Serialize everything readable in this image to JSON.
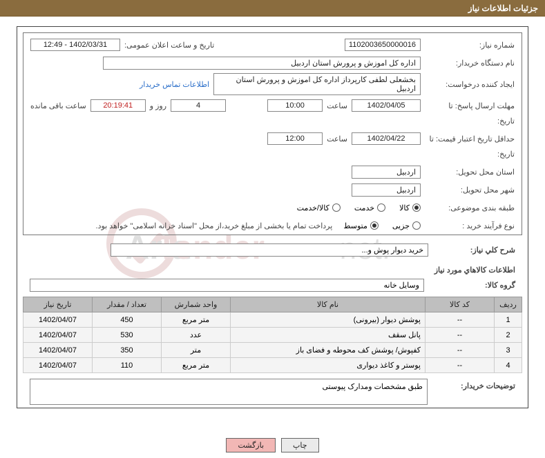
{
  "header": {
    "title": "جزئیات اطلاعات نیاز"
  },
  "fields": {
    "need_no_label": "شماره نیاز:",
    "need_no": "1102003650000016",
    "announce_label": "تاریخ و ساعت اعلان عمومی:",
    "announce_value": "1402/03/31 - 12:49",
    "buyer_org_label": "نام دستگاه خریدار:",
    "buyer_org": "اداره کل اموزش و پرورش استان اردبیل",
    "requester_label": "ایجاد کننده درخواست:",
    "requester": "بخشعلی لطفی کارپرداز اداره کل اموزش و پرورش استان اردبیل",
    "contact_link": "اطلاعات تماس خریدار",
    "deadline_until_label": "مهلت ارسال پاسخ: تا",
    "deadline_date": "1402/04/05",
    "hour_label": "ساعت",
    "deadline_time": "10:00",
    "days_count": "4",
    "days_label": "روز و",
    "countdown": "20:19:41",
    "remaining_label": "ساعت باقی مانده",
    "date_sublabel": "تاریخ:",
    "validity_until_label": "حداقل تاریخ اعتبار قیمت: تا",
    "validity_date": "1402/04/22",
    "validity_time": "12:00",
    "delivery_province_label": "استان محل تحویل:",
    "delivery_province": "اردبیل",
    "delivery_city_label": "شهر محل تحویل:",
    "delivery_city": "اردبیل",
    "subject_class_label": "طبقه بندی موضوعی:",
    "subject_options": [
      "کالا",
      "خدمت",
      "کالا/خدمت"
    ],
    "subject_selected": 0,
    "purchase_type_label": "نوع فرآیند خرید :",
    "purchase_options": [
      "جزیی",
      "متوسط"
    ],
    "purchase_selected": 1,
    "purchase_note": "پرداخت تمام یا بخشی از مبلغ خرید،از محل \"اسناد خزانه اسلامی\" خواهد بود."
  },
  "summary": {
    "title_label": "شرح کلي نياز:",
    "title_value": "خرید دیوار پوش و...",
    "goods_info_label": "اطلاعات كالاهاي مورد نياز",
    "goods_group_label": "گروه کالا:",
    "goods_group_value": "وسایل خانه"
  },
  "table": {
    "headers": [
      "ردیف",
      "کد کالا",
      "نام کالا",
      "واحد شمارش",
      "تعداد / مقدار",
      "تاریخ نیاز"
    ],
    "rows": [
      {
        "idx": "1",
        "code": "--",
        "name": "پوشش دیوار (بیرونی)",
        "unit": "متر مربع",
        "qty": "450",
        "date": "1402/04/07"
      },
      {
        "idx": "2",
        "code": "--",
        "name": "پانل سقف",
        "unit": "عدد",
        "qty": "530",
        "date": "1402/04/07"
      },
      {
        "idx": "3",
        "code": "--",
        "name": "کفپوش/ پوشش کف محوطه و فضای باز",
        "unit": "متر",
        "qty": "350",
        "date": "1402/04/07"
      },
      {
        "idx": "4",
        "code": "--",
        "name": "پوستر و کاغذ دیواری",
        "unit": "متر مربع",
        "qty": "110",
        "date": "1402/04/07"
      }
    ]
  },
  "buyer_note": {
    "label": "توضیحات خریدار:",
    "value": "طبق مشخصات ومدارک پیوستی"
  },
  "footer": {
    "print": "چاپ",
    "back": "بازگشت"
  },
  "watermark": "Aria Tender.net"
}
